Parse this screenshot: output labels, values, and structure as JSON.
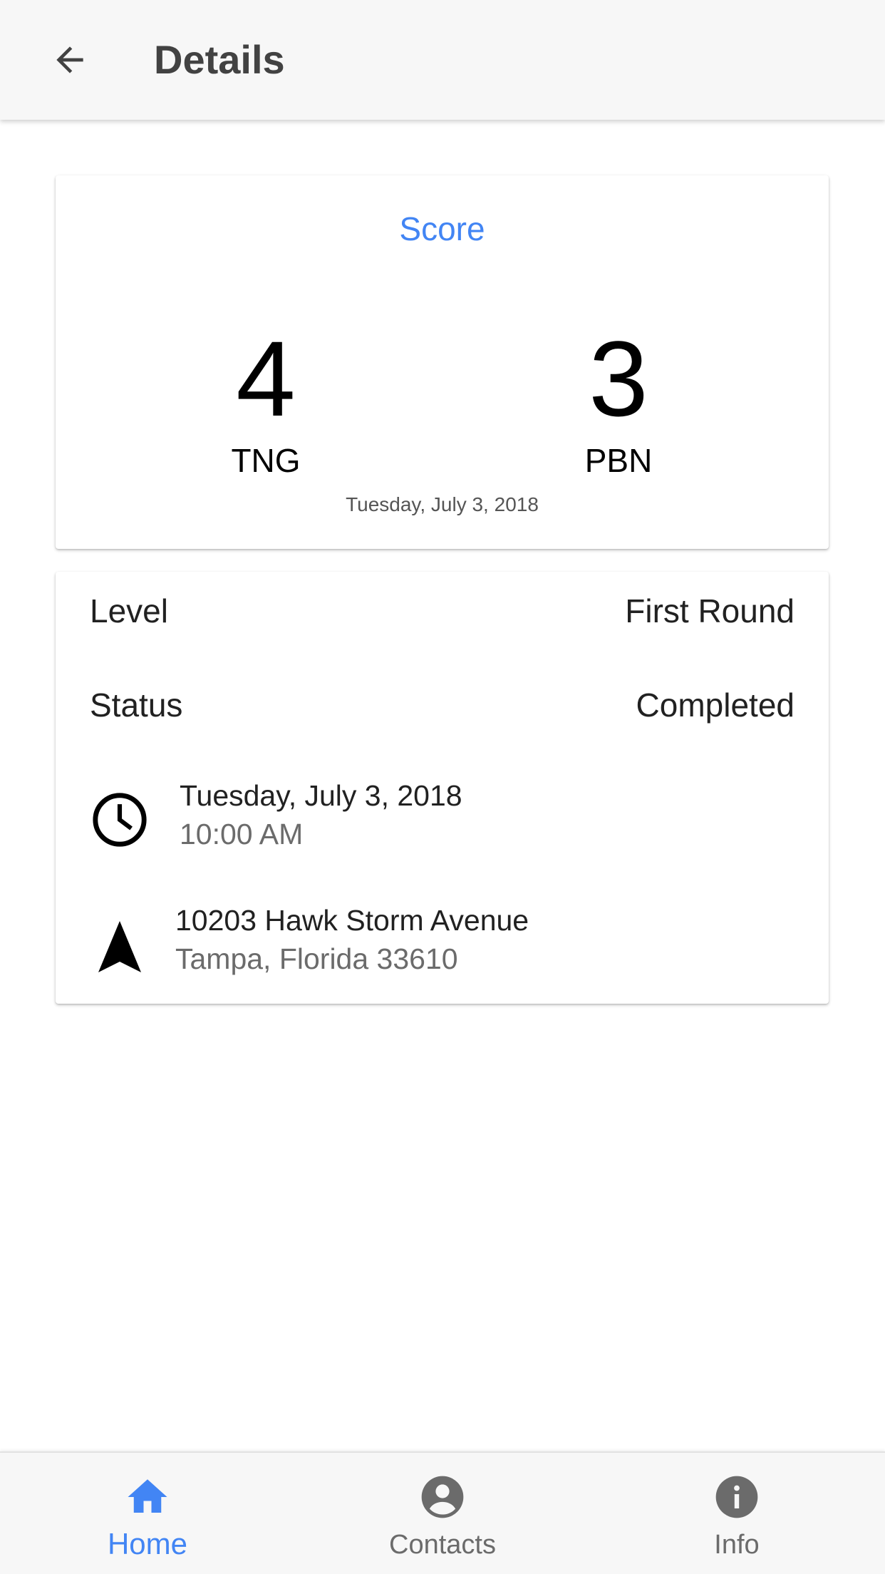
{
  "appbar": {
    "title": "Details",
    "back_icon": "arrow-back-icon"
  },
  "score_card": {
    "label": "Score",
    "home_team": {
      "score": "4",
      "name": "TNG"
    },
    "away_team": {
      "score": "3",
      "name": "PBN"
    },
    "date": "Tuesday, July 3, 2018"
  },
  "details_card": {
    "level": {
      "label": "Level",
      "value": "First Round"
    },
    "status": {
      "label": "Status",
      "value": "Completed"
    },
    "time": {
      "icon": "clock-icon",
      "date": "Tuesday, July 3, 2018",
      "time": "10:00 AM"
    },
    "address": {
      "icon": "navigation-icon",
      "street": "10203 Hawk Storm Avenue",
      "city": "Tampa, Florida 33610"
    }
  },
  "bottom_nav": {
    "items": [
      {
        "label": "Home",
        "icon": "home-icon",
        "active": true
      },
      {
        "label": "Contacts",
        "icon": "account-circle-icon",
        "active": false
      },
      {
        "label": "Info",
        "icon": "info-icon",
        "active": false
      }
    ]
  },
  "colors": {
    "accent": "#4285f4",
    "appbar_bg": "#f7f7f7",
    "inactive": "#6b6b6b"
  }
}
